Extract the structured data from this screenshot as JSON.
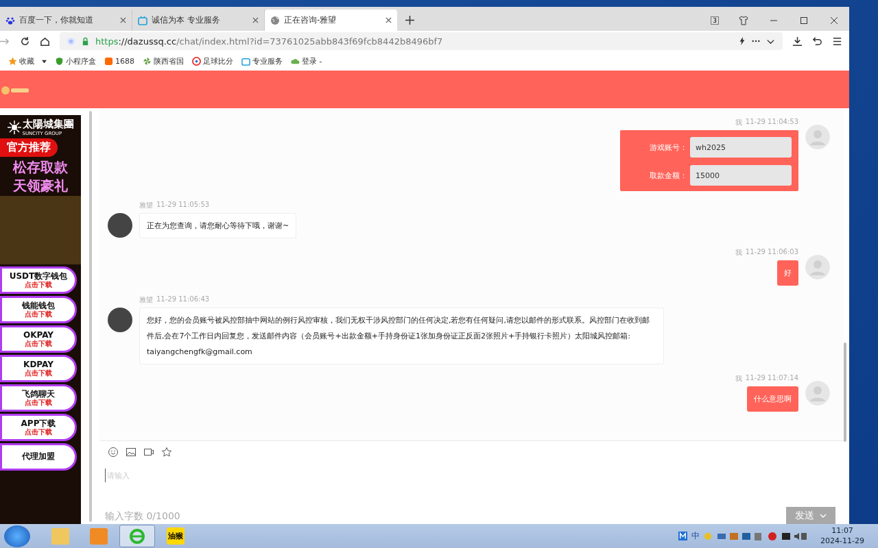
{
  "browser": {
    "tabs": [
      {
        "title": "百度一下，你就知道",
        "selected": false
      },
      {
        "title": "诚信为本 专业服务",
        "selected": false
      },
      {
        "title": "正在咨询-雅望",
        "selected": true
      }
    ],
    "tab_count": "3",
    "url": {
      "scheme": "https",
      "host": "://dazussq.cc",
      "path": "/chat/index.html?id=73761025abb843f69fcb8442b8496bf7"
    },
    "bookmarks": [
      "收藏",
      "小程序盒",
      "1688",
      "陕西省国",
      "足球比分",
      "专业服务",
      "登录 -"
    ]
  },
  "ad": {
    "brand": "太陽城集團",
    "brand_sub": "SUNCITY GROUP",
    "badge": "官方推荐",
    "slogans": [
      "松存取款",
      "天领豪礼"
    ],
    "buttons": [
      {
        "title": "USDT数字钱包",
        "sub": "点击下载"
      },
      {
        "title": "钱能钱包",
        "sub": "点击下载"
      },
      {
        "title": "OKPAY",
        "sub": "点击下载"
      },
      {
        "title": "KDPAY",
        "sub": "点击下载"
      },
      {
        "title": "飞鸽聊天",
        "sub": "点击下载"
      },
      {
        "title": "APP下载",
        "sub": "点击下载"
      },
      {
        "title": "代理加盟"
      }
    ]
  },
  "messages": [
    {
      "kind": "form",
      "sender": "我",
      "time": "11-29 11:04:53",
      "fields": [
        {
          "label": "游戏账号：",
          "value": "wh2025"
        },
        {
          "label": "取款金额：",
          "value": "15000"
        }
      ]
    },
    {
      "kind": "agent",
      "sender": "雅望",
      "time": "11-29 11:05:53",
      "text": "正在为您查询，请您耐心等待下哦，谢谢~"
    },
    {
      "kind": "mine",
      "sender": "我",
      "time": "11-29 11:06:03",
      "text": "好"
    },
    {
      "kind": "agent",
      "sender": "雅望",
      "time": "11-29 11:06:43",
      "text": "您好，您的会员账号被风控部抽中网站的例行风控审核，我们无权干涉风控部门的任何决定,若您有任何疑问,请您以邮件的形式联系。风控部门在收到邮件后,会在7个工作日内回复您，发送邮件内容（会员账号+出款金额+手持身份证1张加身份证正反面2张照片+手持银行卡照片）太阳城风控邮箱:\ntaiyangchengfk@gmail.com"
    },
    {
      "kind": "mine",
      "sender": "我",
      "time": "11-29 11:07:14",
      "text": "什么意思啊"
    }
  ],
  "composer": {
    "placeholder": "请输入",
    "counter": "输入字数 0/1000",
    "send": "发送"
  },
  "taskbar": {
    "apps": [
      {
        "kind": "folder",
        "selected": false
      },
      {
        "kind": "media",
        "selected": false
      },
      {
        "kind": "ie",
        "selected": true
      },
      {
        "kind": "label",
        "label": "油猴",
        "selected": false
      }
    ],
    "ime": "中",
    "time": "11:07",
    "date": "2024-11-29"
  }
}
